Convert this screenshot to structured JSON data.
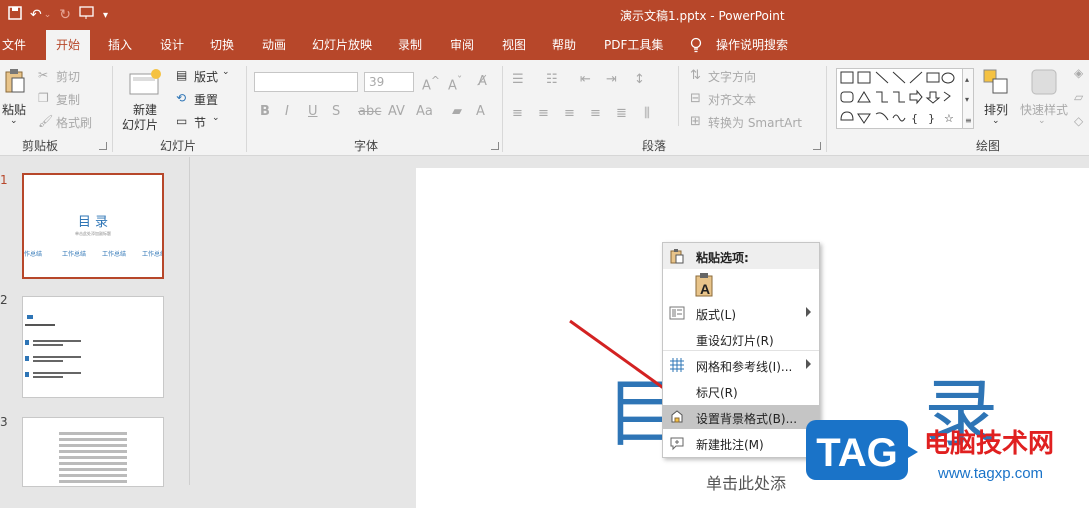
{
  "titlebar": {
    "doc_title": "演示文稿1.pptx - PowerPoint"
  },
  "tabs": [
    {
      "label": "文件"
    },
    {
      "label": "开始"
    },
    {
      "label": "插入"
    },
    {
      "label": "设计"
    },
    {
      "label": "切换"
    },
    {
      "label": "动画"
    },
    {
      "label": "幻灯片放映"
    },
    {
      "label": "录制"
    },
    {
      "label": "审阅"
    },
    {
      "label": "视图"
    },
    {
      "label": "帮助"
    },
    {
      "label": "PDF工具集"
    },
    {
      "label": "操作说明搜索"
    }
  ],
  "ribbon": {
    "clipboard": {
      "group": "剪贴板",
      "paste": "粘贴",
      "cut": "剪切",
      "copy": "复制",
      "format_painter": "格式刷"
    },
    "slides": {
      "group": "幻灯片",
      "new_slide_1": "新建",
      "new_slide_2": "幻灯片",
      "layout": "版式",
      "reset": "重置",
      "section": "节"
    },
    "font": {
      "group": "字体",
      "size": "39"
    },
    "paragraph": {
      "group": "段落",
      "text_direction": "文字方向",
      "align_text": "对齐文本",
      "smartart": "转换为 SmartArt"
    },
    "drawing": {
      "group": "绘图",
      "arrange": "排列",
      "quick_styles": "快速样式"
    }
  },
  "slides": [
    {
      "num": "1",
      "title": "目  录",
      "subtitle": "单击此处添加副标题",
      "items": [
        "作总结",
        "工作总结",
        "工作总结",
        "工作总结"
      ]
    },
    {
      "num": "2"
    },
    {
      "num": "3"
    }
  ],
  "slide_canvas": {
    "title_left": "目",
    "title_right": "录",
    "subtitle": "单击此处添"
  },
  "context_menu": {
    "paste_header": "粘贴选项:",
    "items": [
      {
        "label": "版式(L)"
      },
      {
        "label": "重设幻灯片(R)"
      },
      {
        "label": "网格和参考线(I)..."
      },
      {
        "label": "标尺(R)"
      },
      {
        "label": "设置背景格式(B)..."
      },
      {
        "label": "新建批注(M)"
      }
    ]
  },
  "watermark": {
    "brand": "TAG",
    "site_name": "电脑技术网",
    "url": "www.tagxp.com"
  },
  "colors": {
    "accent": "#b7472a",
    "title_blue": "#2e75b6",
    "arrow_red": "#d32222"
  }
}
